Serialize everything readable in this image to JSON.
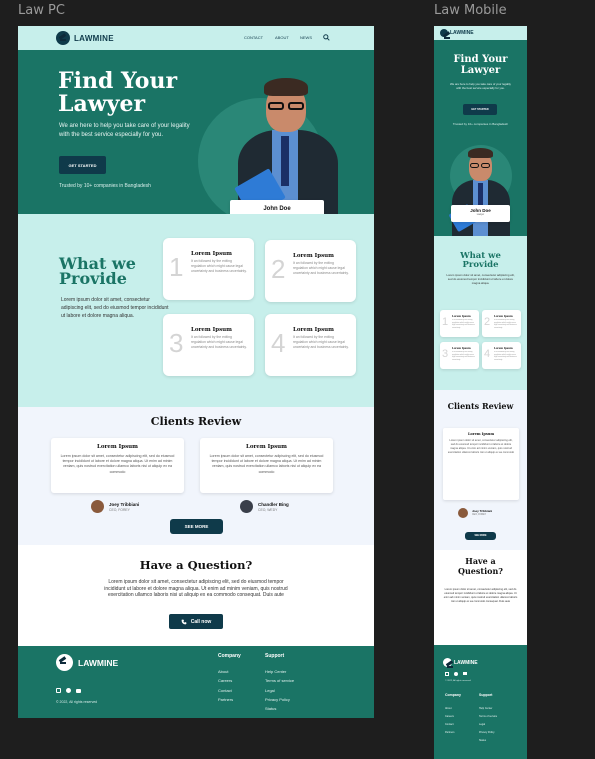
{
  "labels": {
    "pc": "Law PC",
    "mobile": "Law Mobile"
  },
  "brand": {
    "name": "LAWMINE",
    "teal": "#1a7465",
    "mint": "#c7efeb",
    "dark": "#0f3a4a"
  },
  "nav": {
    "items": [
      "CONTACT",
      "ABOUT",
      "NEWS"
    ],
    "search_icon": "search-icon"
  },
  "hero": {
    "title_line1": "Find Your",
    "title_line2": "Lawyer",
    "subtitle": "We are here to help you take care of your legality with the best service especially for you.",
    "cta": "GET STARTED",
    "trusted": "Trusted by 10+ companies in Bangladesh",
    "person_name": "John Doe",
    "person_role": "Lawyer"
  },
  "what": {
    "title_line1": "What we",
    "title_line2": "Provide",
    "description": "Lorem ipsum dolor sit amet, consectetur adipiscing elit, sed do eiusmod tempor incididunt ut labore et dolore magna aliqua.",
    "cards": [
      {
        "number": "1",
        "title": "Lorem Ipsum",
        "text": "It an followed by the exiting regulation which might cause legal uncertainty and business uncertainty."
      },
      {
        "number": "2",
        "title": "Lorem Ipsum",
        "text": "It an followed by the exiting regulation which might cause legal uncertainty and business uncertainty."
      },
      {
        "number": "3",
        "title": "Lorem Ipsum",
        "text": "It an followed by the exiting regulation which might cause legal uncertainty and business uncertainty."
      },
      {
        "number": "4",
        "title": "Lorem Ipsum",
        "text": "It an followed by the exiting regulation which might cause legal uncertainty and business uncertainty."
      }
    ]
  },
  "reviews": {
    "title": "Clients Review",
    "items": [
      {
        "title": "Lorem Ipsum",
        "text": "Lorem ipsum dolor sit amet, consectetur adipiscing elit, sed do eiusmod tempor incididunt ut labore et dolore magna aliqua. Ut enim ad minim veniam, quis nostrud exercitation ullamco laboris nisi ut aliquip ex ea commodo",
        "name": "Joey Tribbiani",
        "role": "CEO, FOREY"
      },
      {
        "title": "Lorem Ipsum",
        "text": "Lorem ipsum dolor sit amet, consectetur adipiscing elit, sed do eiusmod tempor incididunt ut labore et dolore magna aliqua. Ut enim ad minim veniam, quis nostrud exercitation ullamco laboris nisi ut aliquip ex ea commodo",
        "name": "Chandler Bing",
        "role": "CEO, WEDY"
      }
    ],
    "see_more": "SEE MORE",
    "mobile_see_more": "SEE MORE"
  },
  "question": {
    "title": "Have a Question?",
    "mobile_title_line1": "Have a",
    "mobile_title_line2": "Question?",
    "text": "Lorem ipsum dolor sit amet, consectetur adipiscing elit, sed do eiusmod tempor incididunt ut labore et dolore magna aliqua. Ut enim ad minim veniam, quis nostrud exercitation ullamco laboris nisi ut aliquip ex ea commodo consequat. Duis aute",
    "call": "Call now"
  },
  "footer": {
    "company_heading": "Company",
    "company_links": [
      "About",
      "Careers",
      "Contact",
      "Partners"
    ],
    "support_heading": "Support",
    "support_links": [
      "Help Center",
      "Terms of service",
      "Legal",
      "Privacy Policy",
      "Status"
    ],
    "copyright": "© 2022, All rights reserved",
    "socials": [
      "instagram-icon",
      "twitter-icon",
      "youtube-icon"
    ]
  }
}
